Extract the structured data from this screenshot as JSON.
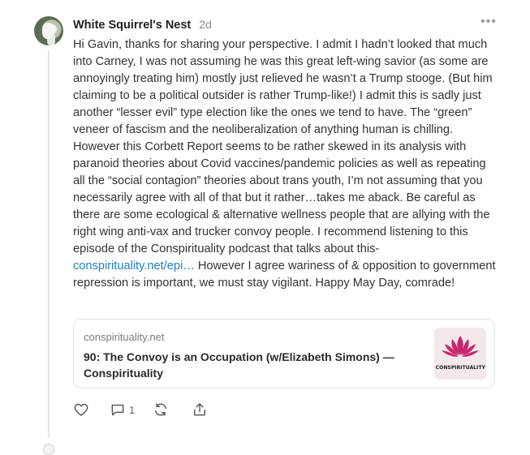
{
  "comment": {
    "author": "White Squirrel's Nest",
    "time": "2d",
    "more_icon": "•••",
    "body_part1": "Hi Gavin, thanks for sharing your perspective. I admit I hadn’t looked that much into Carney, I was not assuming he was this great left-wing savior (as some are annoyingly treating him) mostly just relieved he wasn’t a Trump stooge. (But him claiming to be a political outsider is rather Trump-like!) I admit this is sadly just another “lesser evil” type election like the ones we tend to have. The “green” veneer of fascism and the neoliberalization of anything human is chilling. However this Corbett Report seems to be rather skewed in its analysis with paranoid theories about Covid vaccines/pandemic policies as well as repeating all the “social contagion” theories about trans youth, I’m not assuming that you necessarily agree with all of that but it rather…takes me aback. Be careful as there are some ecological & alternative wellness people that are allying with the right wing anti-vax and trucker convoy people. I recommend listening to this episode of the Conspirituality podcast that talks about this- ",
    "body_link": "conspirituality.net/epi…",
    "body_part2": " However I agree wariness of & opposition to government repression is important, we must stay vigilant. Happy May Day, comrade!"
  },
  "link_card": {
    "domain": "conspirituality.net",
    "title": "90: The Convoy is an Occupation (w/Elizabeth Simons) — Conspirituality",
    "thumb_text": "CONSPIRITUALITY"
  },
  "actions": {
    "like_icon": "heart-icon",
    "reply_icon": "comment-icon",
    "reply_count": "1",
    "restack_icon": "restack-icon",
    "share_icon": "share-icon"
  },
  "colors": {
    "link": "#1f7fc7",
    "lotus": "#c8256a",
    "muted": "#8d8d8d"
  }
}
